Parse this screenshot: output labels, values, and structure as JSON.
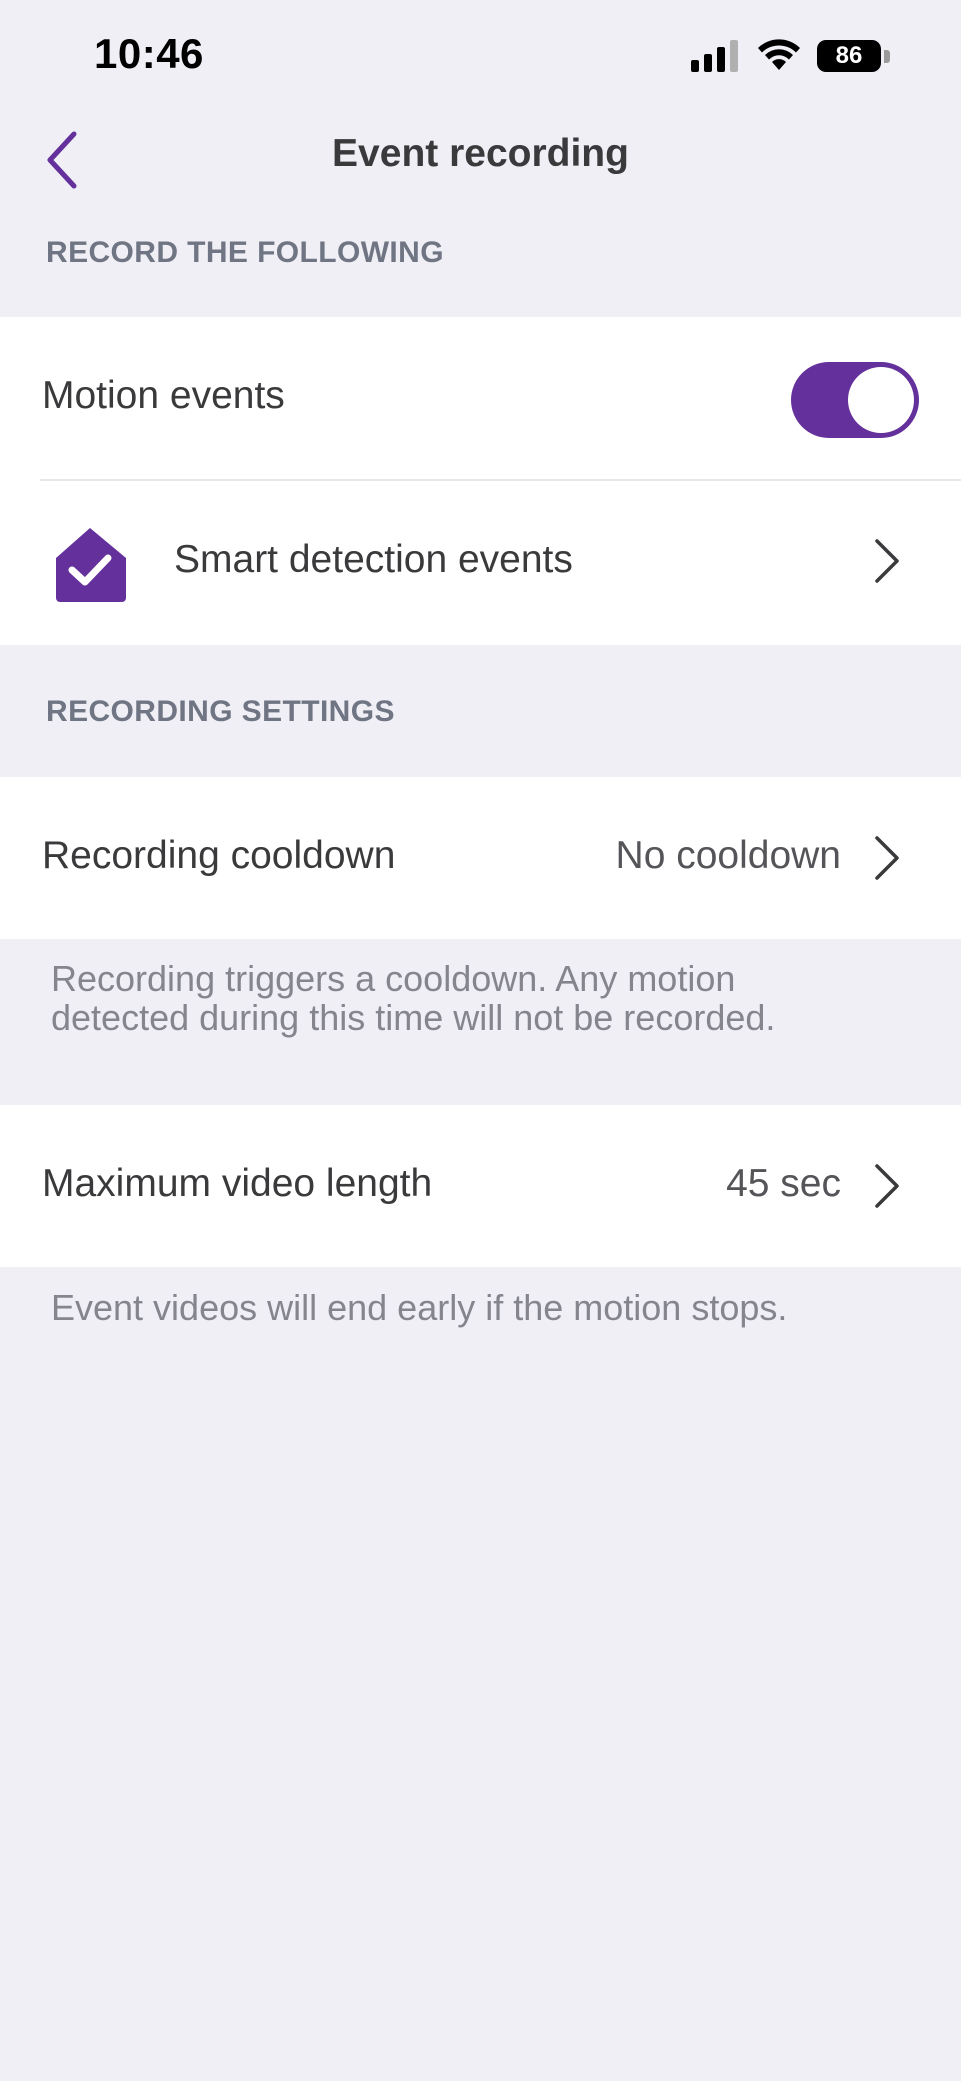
{
  "status_bar": {
    "time": "10:46",
    "battery": "86"
  },
  "header": {
    "title": "Event recording",
    "back_icon": "chevron-left-icon"
  },
  "sections": {
    "record": {
      "header": "RECORD THE FOLLOWING",
      "motion_label": "Motion events",
      "motion_enabled": true,
      "smart_label": "Smart detection events",
      "smart_icon": "home-check-icon"
    },
    "settings": {
      "header": "RECORDING SETTINGS",
      "cooldown_label": "Recording cooldown",
      "cooldown_value": "No cooldown",
      "cooldown_footnote_line1": "Recording triggers a cooldown. Any motion",
      "cooldown_footnote_line2": "detected during this time will not be recorded.",
      "max_length_label": "Maximum video length",
      "max_length_value": "45 sec",
      "max_length_footnote": "Event videos will end early if the motion stops."
    }
  },
  "colors": {
    "accent": "#64309b",
    "background": "#efeff5",
    "section_header": "#707584",
    "footnote": "#85858d"
  }
}
